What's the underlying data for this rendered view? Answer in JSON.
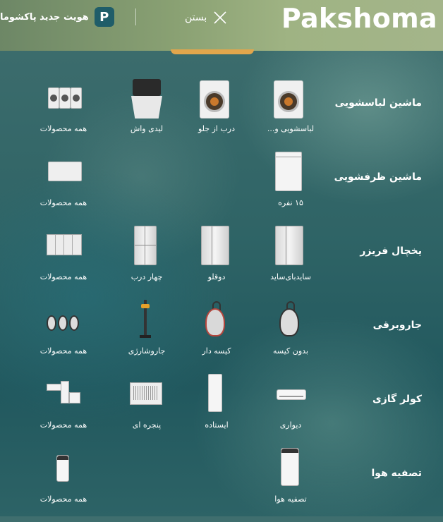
{
  "header": {
    "logo": "Pakshoma",
    "close_label": "بستن",
    "brand_id_label": "هویت جدید پاکشوما",
    "brand_badge": "P"
  },
  "categories": [
    {
      "label": "ماشین لباسشویی",
      "items": [
        {
          "label": "لباسشویی و..."
        },
        {
          "label": "درب از جلو"
        },
        {
          "label": "لیدی واش"
        },
        {
          "label": "همه محصولات"
        }
      ]
    },
    {
      "label": "ماشین ظرفشویی",
      "items": [
        {
          "label": "۱۵ نفره"
        },
        {
          "label": "همه محصولات"
        }
      ]
    },
    {
      "label": "یخچال فریزر",
      "items": [
        {
          "label": "سایدبای‌ساید"
        },
        {
          "label": "دوقلو"
        },
        {
          "label": "چهار درب"
        },
        {
          "label": "همه محصولات"
        }
      ]
    },
    {
      "label": "جاروبرقی",
      "items": [
        {
          "label": "بدون کیسه"
        },
        {
          "label": "کیسه دار"
        },
        {
          "label": "جاروشارژی"
        },
        {
          "label": "همه محصولات"
        }
      ]
    },
    {
      "label": "کولر گازی",
      "items": [
        {
          "label": "دیواری"
        },
        {
          "label": "ایستاده"
        },
        {
          "label": "پنجره ای"
        },
        {
          "label": "همه محصولات"
        }
      ]
    },
    {
      "label": "تصفیه هوا",
      "items": [
        {
          "label": "تصفیه هوا"
        },
        {
          "label": "همه محصولات"
        }
      ]
    }
  ]
}
